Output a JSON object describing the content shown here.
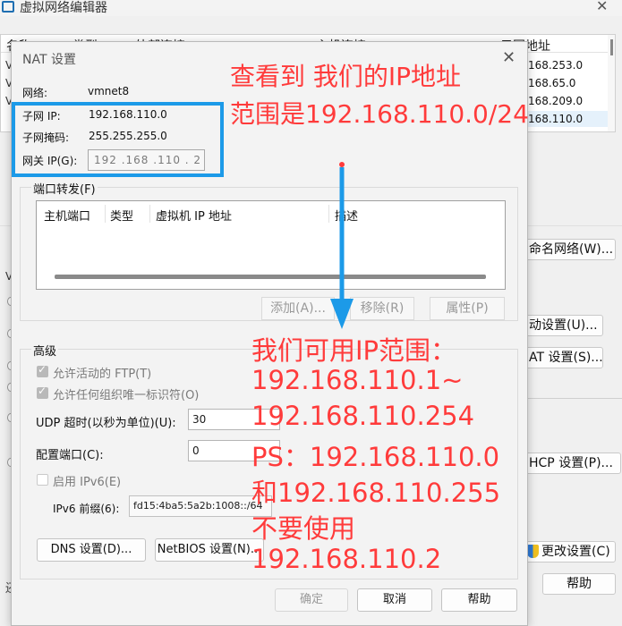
{
  "background_window": {
    "title": "虚拟网络编辑器",
    "close": "✕",
    "col_name": "名称",
    "col_type": "类型",
    "col_external": "外部连接",
    "col_host": "主机连接",
    "col_subnet": "子网地址",
    "row_v1": "V",
    "row_v2": "V",
    "row_v3": "V",
    "row_v4": "V",
    "subnets": [
      "168.253.0",
      "168.65.0",
      "168.209.0",
      "168.110.0"
    ],
    "btn_rename": "命名网络(W)...",
    "btn_auto": "动设置(U)...",
    "btn_nat": "AT 设置(S)...",
    "btn_dhcp": "HCP 设置(P)...",
    "btn_change": "更改设置(C)",
    "btn_help": "帮助",
    "bottom_label": "还"
  },
  "nat_dialog": {
    "title": "NAT 设置",
    "close": "✕",
    "network_label": "网络:",
    "network_value": "vmnet8",
    "subnet_ip_label": "子网 IP:",
    "subnet_ip_value": "192.168.110.0",
    "subnet_mask_label": "子网掩码:",
    "subnet_mask_value": "255.255.255.0",
    "gateway_label": "网关 IP(G):",
    "gateway_value": "192 .168 .110 . 2",
    "port_forwarding": {
      "title": "端口转发(F)",
      "col_host_port": "主机端口",
      "col_type": "类型",
      "col_vm_ip": "虚拟机 IP 地址",
      "col_desc": "描述",
      "btn_add": "添加(A)...",
      "btn_remove": "移除(R)",
      "btn_props": "属性(P)"
    },
    "advanced": {
      "title": "高级",
      "allow_ftp": "允许活动的 FTP(T)",
      "allow_oui": "允许任何组织唯一标识符(O)",
      "udp_label": "UDP 超时(以秒为单位)(U):",
      "udp_value": "30",
      "cfg_port_label": "配置端口(C):",
      "cfg_port_value": "0",
      "enable_ipv6": "启用 IPv6(E)",
      "ipv6_prefix_label": "IPv6 前缀(6):",
      "ipv6_prefix_value": "fd15:4ba5:5a2b:1008::/64",
      "btn_dns": "DNS 设置(D)...",
      "btn_netbios": "NetBIOS 设置(N)..."
    },
    "btn_ok": "确定",
    "btn_cancel": "取消",
    "btn_help": "帮助"
  },
  "annotations": {
    "top_line1": "查看到 我们的IP地址",
    "top_line2": "范围是192.168.110.0/24",
    "lines": [
      "我们可用IP范围：",
      "192.168.110.1~",
      "192.168.110.254",
      "PS：192.168.110.0",
      "和192.168.110.255",
      "不要使用",
      "192.168.110.2"
    ],
    "text_color": "#ff3b3b",
    "arrow_color": "#1c9ae8",
    "highlight_color": "#1c9ae8"
  }
}
